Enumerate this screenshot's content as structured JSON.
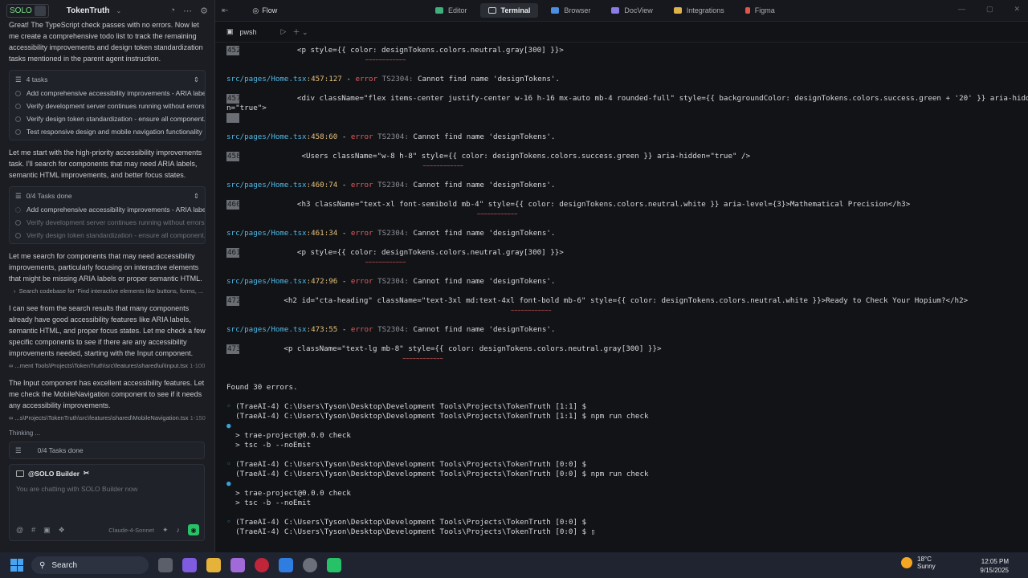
{
  "left": {
    "logo": "SOLO",
    "title": "TokenTruth",
    "messages": {
      "m1": "Great! The TypeScript check passes with no errors. Now let me create a comprehensive todo list to track the remaining accessibility improvements and design token standardization tasks mentioned in the parent agent instruction.",
      "m2": "Let me start with the high-priority accessibility improvements task. I'll search for components that may need ARIA labels, semantic HTML improvements, and better focus states.",
      "m3": "Let me search for components that may need accessibility improvements, particularly focusing on interactive elements that might be missing ARIA labels or proper semantic HTML.",
      "m4": "I can see from the search results that many components already have good accessibility features like ARIA labels, semantic HTML, and proper focus states. Let me check a few specific components to see if there are any accessibility improvements needed, starting with the Input component.",
      "m5": "The Input component has excellent accessibility features. Let me check the MobileNavigation component to see if it needs any accessibility improvements."
    },
    "tasklist1": {
      "count": "4 tasks",
      "items": [
        "Add comprehensive accessibility improvements - ARIA label...",
        "Verify development server continues running without errors...",
        "Verify design token standardization - ensure all component...",
        "Test responsive design and mobile navigation functionality"
      ]
    },
    "tasklist2": {
      "count": "0/4 Tasks done",
      "items": [
        "Add comprehensive accessibility improvements - ARIA label...",
        "Verify development server continues running without errors...",
        "Verify design token standardization - ensure all component..."
      ]
    },
    "search_line": "Search codebase for 'Find interactive elements like buttons, forms, ...",
    "file1": "...ment Tools\\Projects\\TokenTruth\\src\\features\\shared\\ui\\Input.tsx",
    "file1_range": "1-100",
    "file2": "...s\\Projects\\TokenTruth\\src\\features\\shared\\MobileNavigation.tsx",
    "file2_range": "1-150",
    "thinking": "Thinking ...",
    "tasks_done": "0/4 Tasks done",
    "composer": {
      "builder": "@SOLO Builder",
      "placeholder": "You are chatting with SOLO Builder now",
      "model": "Claude-4-Sonnet"
    }
  },
  "topbar": {
    "flow": "Flow",
    "tabs": [
      "Editor",
      "Terminal",
      "Browser",
      "DocView",
      "Integrations",
      "Figma"
    ]
  },
  "terminal": {
    "tab": "pwsh",
    "lines": {
      "l452": "             <p style={{ color: designTokens.colors.neutral.gray[300] }}>",
      "e457": ":457:127",
      "l457": "             <div className=\"flex items-center justify-center w-16 h-16 mx-auto mb-4 rounded-full\" style={{ backgroundColor: designTokens.colors.success.green + '20' }} aria-hidde",
      "l457b": "n=\"true\">",
      "e458": ":458:60",
      "l458": "              <Users className=\"w-8 h-8\" style={{ color: designTokens.colors.success.green }} aria-hidden=\"true\" />",
      "e460": ":460:74",
      "l460": "             <h3 className=\"text-xl font-semibold mb-4\" style={{ color: designTokens.colors.neutral.white }} aria-level={3}>Mathematical Precision</h3>",
      "e461": ":461:34",
      "l461": "             <p style={{ color: designTokens.colors.neutral.gray[300] }}>",
      "e472": ":472:96",
      "l472": "          <h2 id=\"cta-heading\" className=\"text-3xl md:text-4xl font-bold mb-6\" style={{ color: designTokens.colors.neutral.white }}>Ready to Check Your Hopium?</h2>",
      "e473": ":473:55",
      "l473": "          <p className=\"text-lg mb-8\" style={{ color: designTokens.colors.neutral.gray[300] }}>",
      "found": "Found 30 errors.",
      "p1": "(TraeAI-4) C:\\Users\\Tyson\\Desktop\\Development Tools\\Projects\\TokenTruth [1:1] $",
      "p2": "(TraeAI-4) C:\\Users\\Tyson\\Desktop\\Development Tools\\Projects\\TokenTruth [1:1] $ ",
      "p3": "(TraeAI-4) C:\\Users\\Tyson\\Desktop\\Development Tools\\Projects\\TokenTruth [0:0] $",
      "p4": "(TraeAI-4) C:\\Users\\Tyson\\Desktop\\Development Tools\\Projects\\TokenTruth [0:0] $ ",
      "p5": "(TraeAI-4) C:\\Users\\Tyson\\Desktop\\Development Tools\\Projects\\TokenTruth [0:0] $",
      "p6": "(TraeAI-4) C:\\Users\\Tyson\\Desktop\\Development Tools\\Projects\\TokenTruth [0:0] $ ",
      "cmd": "npm run check",
      "check": "> trae-project@0.0.0 check",
      "tsc": "> tsc -b --noEmit"
    },
    "file": "src/pages/Home.tsx",
    "error_word": "error",
    "error_code": "TS2304:",
    "error_msg": "Cannot find name 'designTokens'.",
    "line_numbers": [
      "452",
      "457",
      "458",
      "460",
      "461",
      "472",
      "473"
    ]
  },
  "taskbar": {
    "search": "Search",
    "temp": "18°C",
    "weather": "Sunny",
    "time": "12:05 PM",
    "date": "9/15/2025"
  }
}
